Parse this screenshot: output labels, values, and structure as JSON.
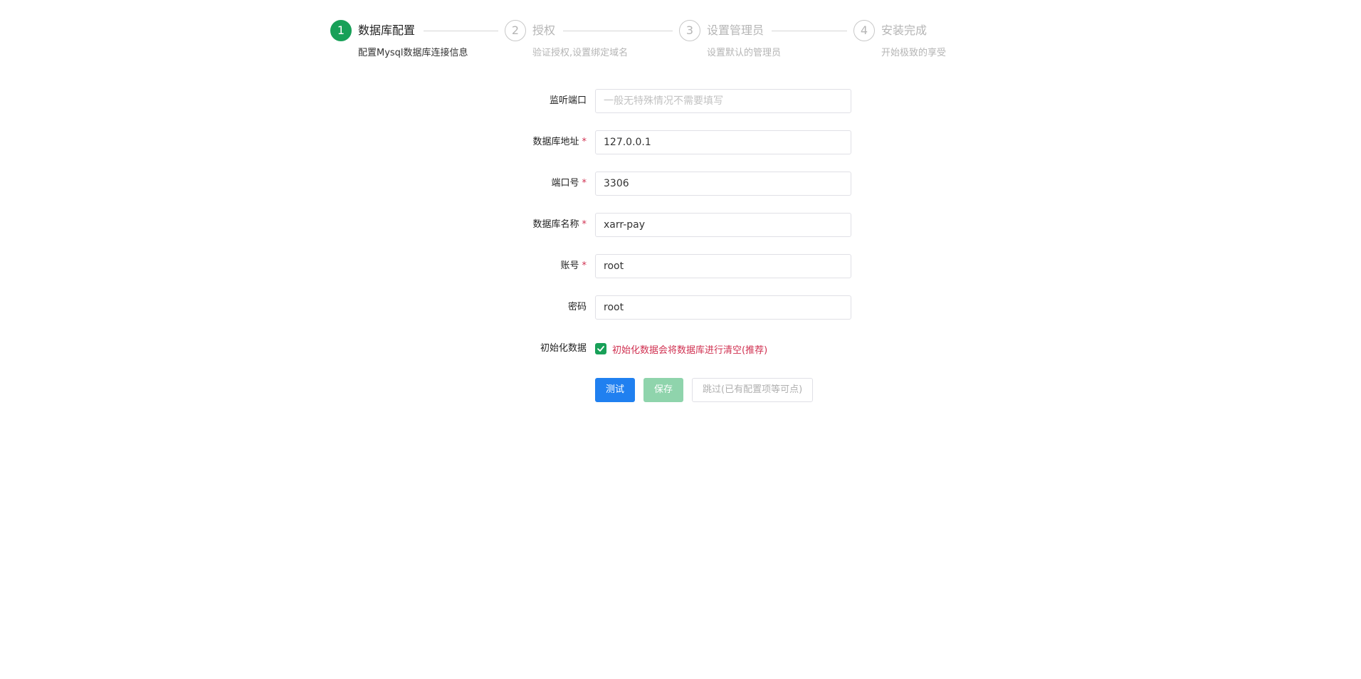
{
  "steps": [
    {
      "number": "1",
      "title": "数据库配置",
      "desc": "配置Mysql数据库连接信息",
      "status": "active"
    },
    {
      "number": "2",
      "title": "授权",
      "desc": "验证授权,设置绑定域名",
      "status": "wait"
    },
    {
      "number": "3",
      "title": "设置管理员",
      "desc": "设置默认的管理员",
      "status": "wait"
    },
    {
      "number": "4",
      "title": "安装完成",
      "desc": "开始极致的享受",
      "status": "wait"
    }
  ],
  "form": {
    "listen_port": {
      "label": "监听端口",
      "value": "",
      "placeholder": "一般无特殊情况不需要填写"
    },
    "db_host": {
      "label": "数据库地址",
      "value": "127.0.0.1",
      "required": "*"
    },
    "db_port": {
      "label": "端口号",
      "value": "3306",
      "required": "*"
    },
    "db_name": {
      "label": "数据库名称",
      "value": "xarr-pay",
      "required": "*"
    },
    "account": {
      "label": "账号",
      "value": "root",
      "required": "*"
    },
    "password": {
      "label": "密码",
      "value": "root"
    },
    "init_data": {
      "label": "初始化数据",
      "checked": true,
      "text": "初始化数据会将数据库进行清空(推荐)"
    }
  },
  "buttons": {
    "test": "测试",
    "save": "保存",
    "skip": "跳过(已有配置项等可点)"
  },
  "colors": {
    "primary": "#2080f0",
    "success": "#18a058",
    "danger": "#d03050"
  }
}
